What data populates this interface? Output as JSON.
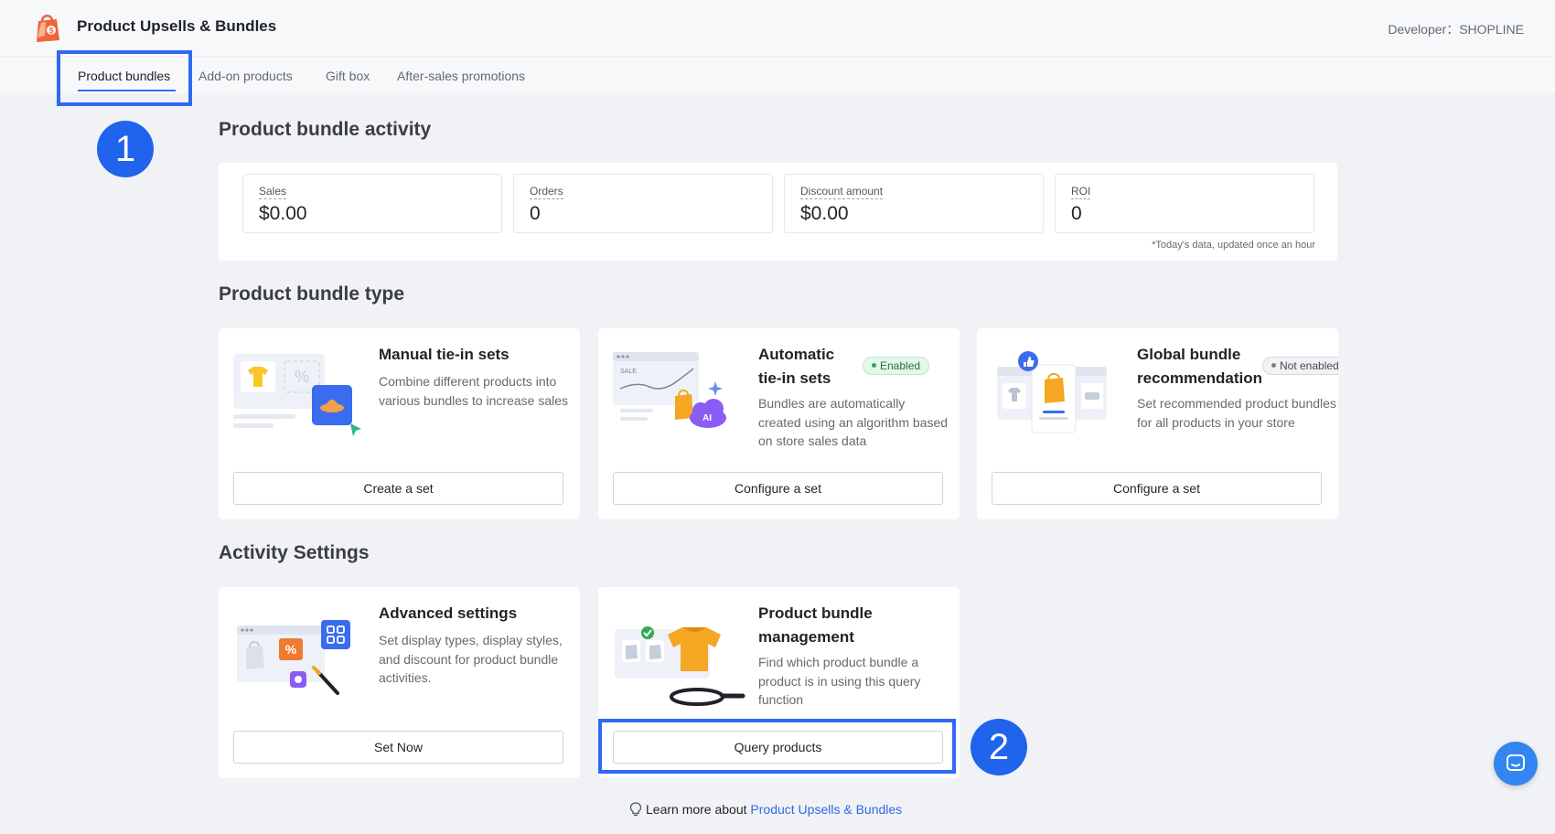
{
  "header": {
    "app_title": "Product Upsells & Bundles",
    "developer": "Developer：SHOPLINE"
  },
  "tabs": [
    {
      "label": "Product bundles",
      "active": true
    },
    {
      "label": "Add-on products",
      "active": false
    },
    {
      "label": "Gift box",
      "active": false
    },
    {
      "label": "After-sales promotions",
      "active": false
    }
  ],
  "annotations": {
    "step1": "1",
    "step2": "2",
    "highlight_color": "#2e6af0"
  },
  "activity": {
    "title": "Product bundle activity",
    "stats": [
      {
        "label": "Sales",
        "value": "$0.00"
      },
      {
        "label": "Orders",
        "value": "0"
      },
      {
        "label": "Discount amount",
        "value": "$0.00"
      },
      {
        "label": "ROI",
        "value": "0"
      }
    ],
    "note": "*Today's data, updated once an hour"
  },
  "bundle_types": {
    "title": "Product bundle type",
    "cards": [
      {
        "title": "Manual tie-in sets",
        "description": "Combine different products into various bundles to increase sales",
        "button": "Create a set",
        "icon": "manual-bundle-illustration"
      },
      {
        "title": "Automatic tie-in sets",
        "badge": "Enabled",
        "description": "Bundles are automatically created using an algorithm based on store sales data",
        "button": "Configure a set",
        "icon": "ai-bundle-illustration"
      },
      {
        "title": "Global bundle recommendation",
        "badge": "Not enabled",
        "description": "Set recommended product bundles for all products in your store",
        "button": "Configure a set",
        "icon": "global-recommendation-illustration"
      }
    ]
  },
  "activity_settings": {
    "title": "Activity Settings",
    "cards": [
      {
        "title": "Advanced settings",
        "description": "Set display types, display styles, and discount for product bundle activities.",
        "button": "Set Now",
        "icon": "advanced-settings-illustration"
      },
      {
        "title": "Product bundle management",
        "description": "Find which product bundle a product is in using this query function",
        "button": "Query products",
        "icon": "query-management-illustration"
      }
    ]
  },
  "footer": {
    "learn_more_prefix": "Learn more about ",
    "learn_more_link": "Product Upsells & Bundles"
  },
  "colors": {
    "accent": "#2e6ae8",
    "enabled": "#34a853",
    "brand_orange": "#f5a623"
  }
}
